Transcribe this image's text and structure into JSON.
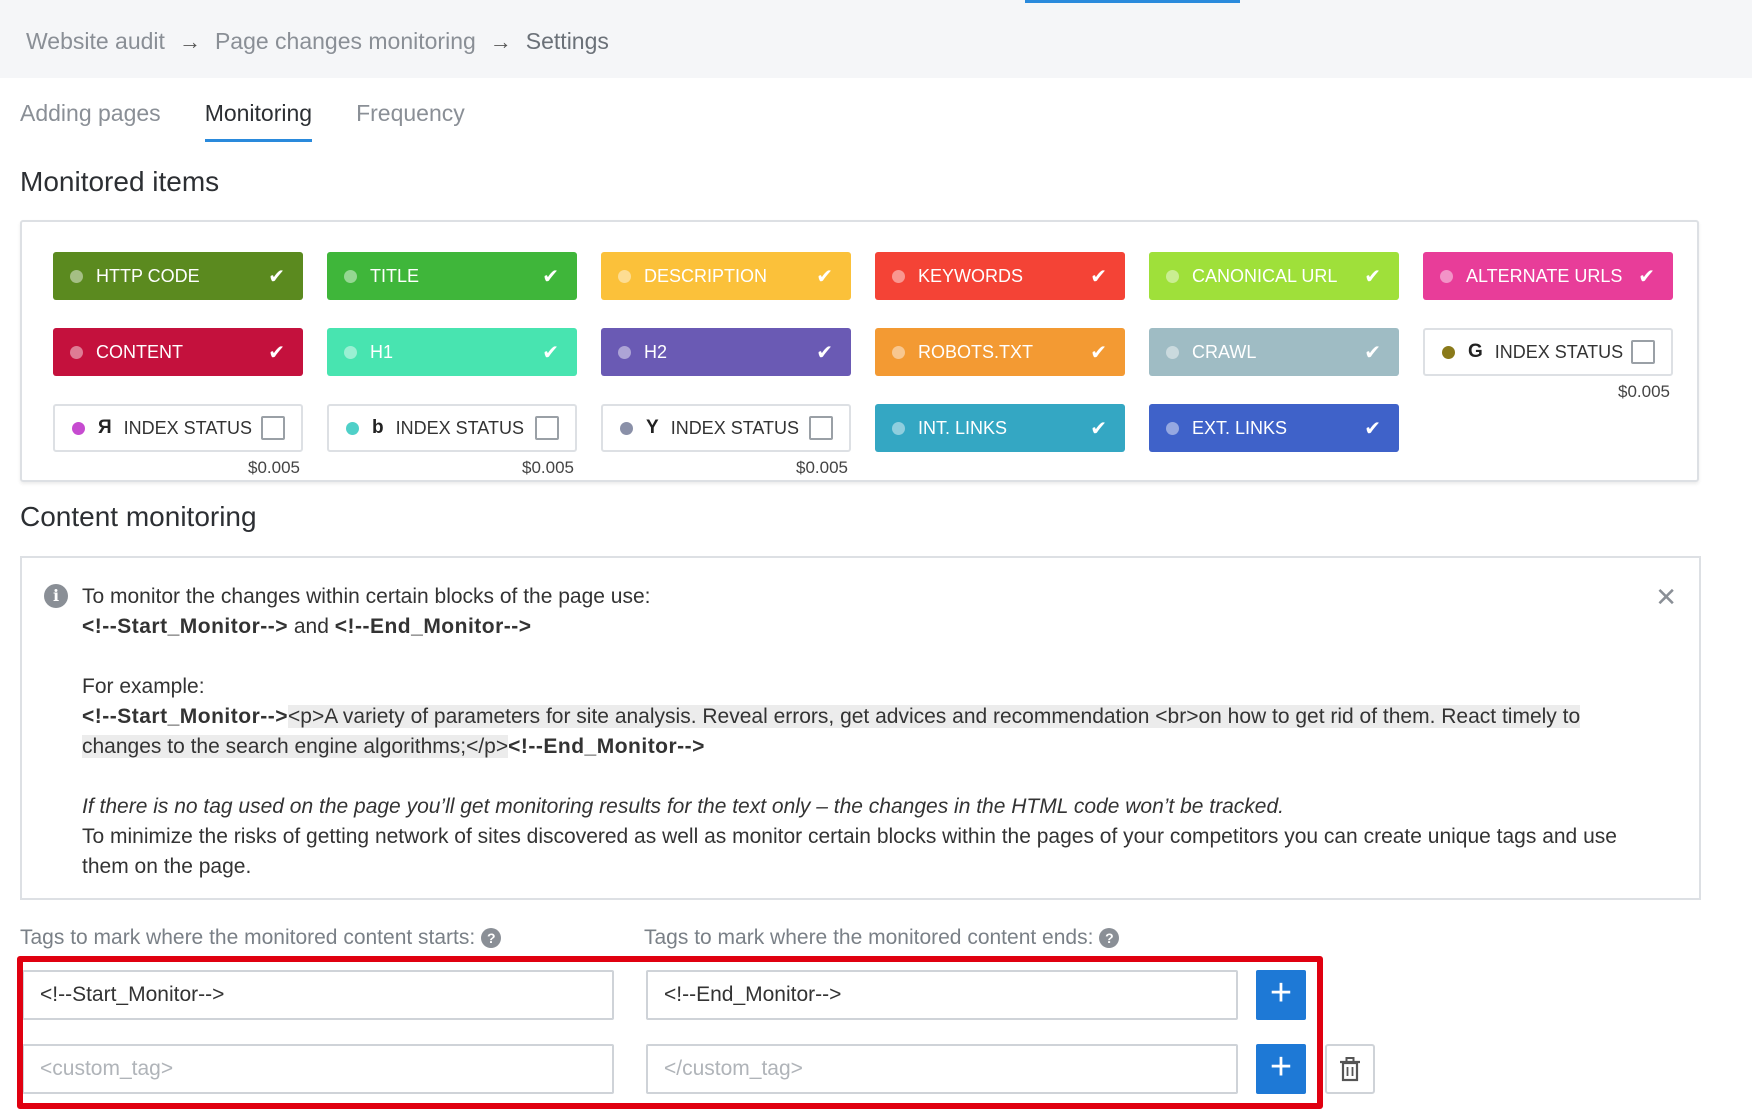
{
  "breadcrumb": {
    "items": [
      "Website audit",
      "Page changes monitoring",
      "Settings"
    ],
    "separator": "→"
  },
  "tabs": [
    {
      "label": "Adding pages",
      "active": false
    },
    {
      "label": "Monitoring",
      "active": true
    },
    {
      "label": "Frequency",
      "active": false
    }
  ],
  "monitored": {
    "title": "Monitored items",
    "items": [
      {
        "label": "HTTP CODE",
        "color": "#5b8a1f",
        "checked": true
      },
      {
        "label": "TITLE",
        "color": "#3fb63a",
        "checked": true
      },
      {
        "label": "DESCRIPTION",
        "color": "#fbc13a",
        "checked": true
      },
      {
        "label": "KEYWORDS",
        "color": "#f44336",
        "checked": true
      },
      {
        "label": "CANONICAL URL",
        "color": "#9fe03a",
        "checked": true
      },
      {
        "label": "ALTERNATE URLS",
        "color": "#e83d99",
        "checked": true
      },
      {
        "label": "CONTENT",
        "color": "#c4113d",
        "checked": true
      },
      {
        "label": "H1",
        "color": "#48e4b0",
        "checked": true
      },
      {
        "label": "H2",
        "color": "#6a5ab4",
        "checked": true
      },
      {
        "label": "ROBOTS.TXT",
        "color": "#f39a33",
        "checked": true
      },
      {
        "label": "CRAWL",
        "color": "#9fbcc4",
        "checked": true
      },
      {
        "label": "INDEX STATUS",
        "engine": "G",
        "dot": "#8a7a1a",
        "checked": false,
        "price": "$0.005"
      },
      {
        "label": "INDEX STATUS",
        "engine": "Я",
        "dot": "#c64bd0",
        "checked": false,
        "price": "$0.005"
      },
      {
        "label": "INDEX STATUS",
        "engine": "b",
        "dot": "#4fd0c8",
        "checked": false,
        "price": "$0.005"
      },
      {
        "label": "INDEX STATUS",
        "engine": "Y",
        "dot": "#8a90a8",
        "checked": false,
        "price": "$0.005"
      },
      {
        "label": "INT. LINKS",
        "color": "#34a7c3",
        "checked": true
      },
      {
        "label": "EXT. LINKS",
        "color": "#3f62c9",
        "checked": true
      }
    ]
  },
  "content_monitoring": {
    "title": "Content monitoring",
    "intro": "To monitor the changes within certain blocks of the page use:",
    "start_tag": "<!--Start_Monitor-->",
    "and": "and",
    "end_tag": "<!--End_Monitor-->",
    "example_label": "For example:",
    "example_body": "<p>A variety of parameters for site analysis. Reveal errors, get advices and recommendation <br>on how to get rid of them. React timely to changes to the search engine algorithms;</p>",
    "note_italic": "If there is no tag used on the page you’ll get monitoring results for the text only – the changes in the HTML code won’t be tracked.",
    "note": "To minimize the risks of getting network of sites discovered as well as monitor certain blocks within the pages of your competitors you can create unique tags and use them on the page."
  },
  "tags": {
    "start_label": "Tags to mark where the monitored content starts:",
    "end_label": "Tags to mark where the monitored content ends:",
    "row1_start": "<!--Start_Monitor-->",
    "row1_end": "<!--End_Monitor-->",
    "row2_start_placeholder": "<custom_tag>",
    "row2_end_placeholder": "</custom_tag>",
    "plus": "+",
    "highlight_color": "#e00010"
  },
  "icons": {
    "check": "✔",
    "info": "i",
    "close": "✕",
    "help": "?"
  }
}
